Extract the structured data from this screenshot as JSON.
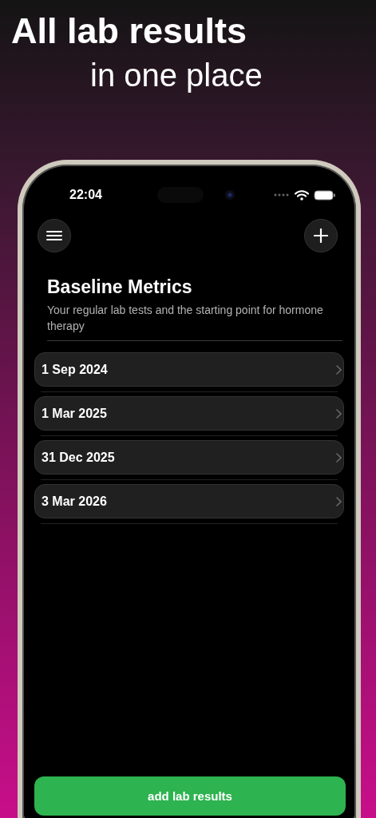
{
  "headline": {
    "line_1": "All lab results",
    "line_2": "in one place"
  },
  "status_bar": {
    "time": "22:04"
  },
  "screen": {
    "title": "Baseline Metrics",
    "subtitle": "Your regular lab tests and the starting point for hormone therapy"
  },
  "entries": [
    {
      "date": "1 Sep 2024"
    },
    {
      "date": "1 Mar 2025"
    },
    {
      "date": "31 Dec 2025"
    },
    {
      "date": "3 Mar 2026"
    }
  ],
  "primary_button": {
    "label": "add lab results"
  }
}
